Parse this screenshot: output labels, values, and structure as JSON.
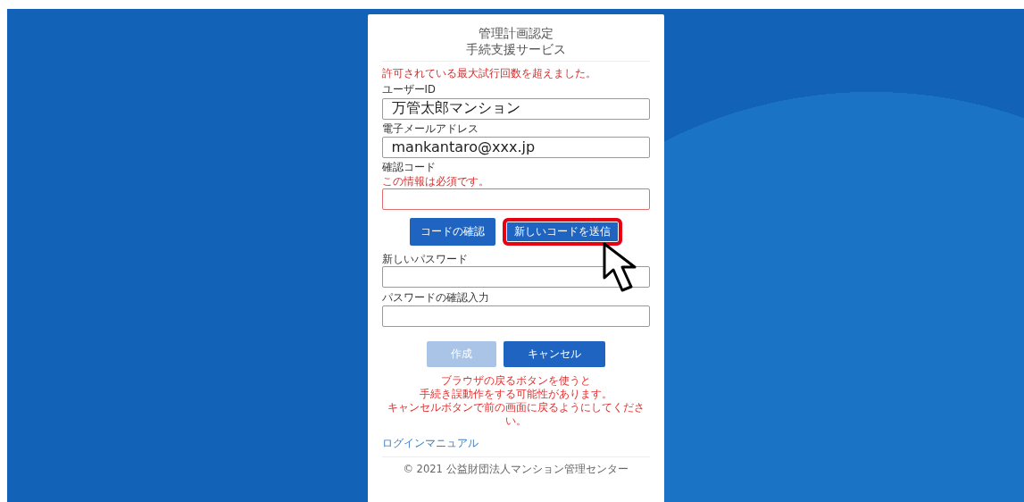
{
  "title_lines": [
    "管理計画認定",
    "手続支援サービス"
  ],
  "error_message": "許可されている最大試行回数を超えました。",
  "fields": [
    {
      "label": "ユーザーID",
      "value": "万管太郎マンション",
      "invalid": false
    },
    {
      "label": "電子メールアドレス",
      "value": "mankantaro@xxx.jp",
      "invalid": false
    },
    {
      "label": "確認コード",
      "error": "この情報は必須です。",
      "invalid": true,
      "buttons": [
        {
          "label": "コードの確認",
          "highlighted": false
        },
        {
          "label": "新しいコードを送信",
          "highlighted": true
        }
      ]
    },
    {
      "label": "新しいパスワード",
      "invalid": false
    },
    {
      "label": "パスワードの確認入力",
      "invalid": false
    }
  ],
  "actions": [
    {
      "label": "作成",
      "disabled": true
    },
    {
      "label": "キャンセル",
      "disabled": false
    }
  ],
  "warning_lines": [
    "ブラウザの戻るボタンを使うと",
    "手続き誤動作をする可能性があります。",
    "キャンセルボタンで前の画面に戻るようにしてください。"
  ],
  "manual_link": "ログインマニュアル",
  "footer": "© 2021 公益財団法人マンション管理センター"
}
